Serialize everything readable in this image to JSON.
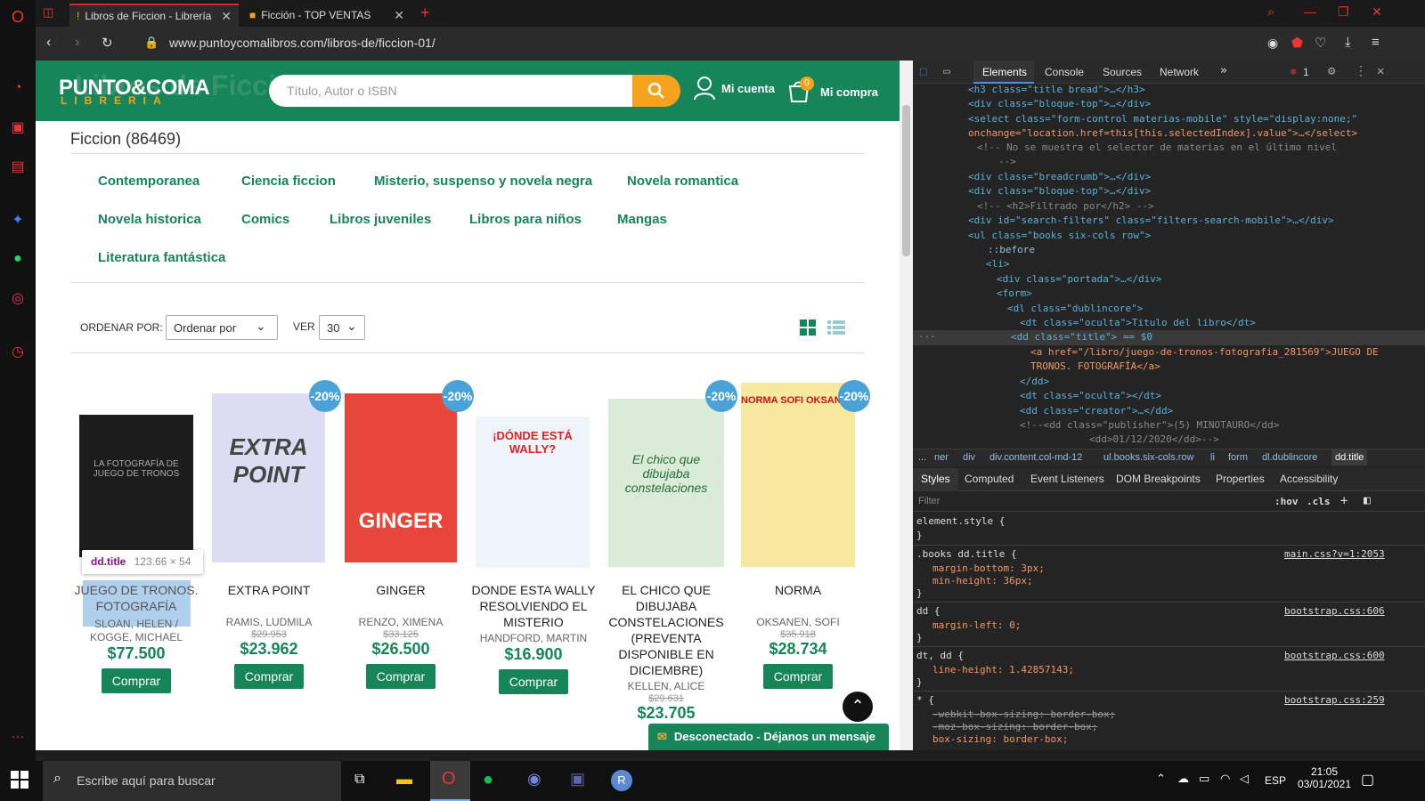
{
  "browser": {
    "tabs": [
      {
        "label": "Libros de Ficcion - Librería"
      },
      {
        "label": "Ficción - TOP VENTAS"
      }
    ],
    "url": "www.puntoycomalibros.com/libros-de/ficcion-01/",
    "new_tab": "+"
  },
  "site": {
    "logo_line1": "PUNTO&COMA",
    "logo_line2": "LIBRERIA",
    "ghost_title": "Libros de Ficcion",
    "search_placeholder": "Título, Autor o ISBN",
    "account_label": "Mi cuenta",
    "cart_label": "Mi compra",
    "cart_count": "0",
    "section_title": "Ficcion (86469)",
    "categories": [
      "Contemporanea",
      "Ciencia ficcion",
      "Misterio, suspenso y novela negra",
      "Novela romantica",
      "Novela historica",
      "Comics",
      "Libros juveniles",
      "Libros para niños",
      "Mangas",
      "Literatura fantástica"
    ],
    "sort_label": "ORDENAR POR:",
    "sort_value": "Ordenar por",
    "view_label": "VER",
    "view_value": "30",
    "tooltip_tag": "dd.title",
    "tooltip_size": "123.66 × 54",
    "chat_label": "Desconectado - Déjanos un mensaje",
    "books": [
      {
        "title": "JUEGO DE TRONOS. FOTOGRAFÍA",
        "author": "SLOAN, HELEN / KOGGE, MICHAEL",
        "old_price": "",
        "price": "$77.500",
        "badge": "",
        "buy": "Comprar",
        "cover_text": "LA FOTOGRAFÍA DE JUEGO DE TRONOS"
      },
      {
        "title": "EXTRA POINT",
        "author": "RAMIS, LUDMILA",
        "old_price": "$29.953",
        "price": "$23.962",
        "badge": "-20%",
        "buy": "Comprar",
        "cover_text": "EXTRA POINT"
      },
      {
        "title": "GINGER",
        "author": "RENZO, XIMENA",
        "old_price": "$33.125",
        "price": "$26.500",
        "badge": "-20%",
        "buy": "Comprar",
        "cover_text": "GINGER"
      },
      {
        "title": "DONDE ESTA WALLY RESOLVIENDO EL MISTERIO",
        "author": "HANDFORD, MARTIN",
        "old_price": "",
        "price": "$16.900",
        "badge": "",
        "buy": "Comprar",
        "cover_text": "¡DÓNDE ESTÁ WALLY?"
      },
      {
        "title": "EL CHICO QUE DIBUJABA CONSTELACIONES (PREVENTA DISPONIBLE EN DICIEMBRE)",
        "author": "KELLEN, ALICE",
        "old_price": "$29.631",
        "price": "$23.705",
        "badge": "-20%",
        "buy": "Comprar",
        "cover_text": "El chico que dibujaba constelaciones"
      },
      {
        "title": "NORMA",
        "author": "OKSANEN, SOFI",
        "old_price": "$35.918",
        "price": "$28.734",
        "badge": "-20%",
        "buy": "Comprar",
        "cover_text": "NORMA SOFI OKSANEN"
      }
    ]
  },
  "devtools": {
    "tabs": [
      "Elements",
      "Console",
      "Sources",
      "Network"
    ],
    "error_count": "1",
    "lines": [
      "<h3 class=\"title bread\">…</h3>",
      "<div class=\"bloque-top\">…</div>",
      "<select class=\"form-control materias-mobile\" style=\"display:none;\"",
      "onchange=\"location.href=this[this.selectedIndex].value\">…</select>",
      "<!-- No se muestra el selector de materias en el último nivel",
      "-->",
      "<div class=\"breadcrumb\">…</div>",
      "<div class=\"bloque-top\">…</div>",
      "<!--      <h2>Filtrado por</h2> -->",
      "<div id=\"search-filters\" class=\"filters-search-mobile\">…</div>",
      "<ul class=\"books six-cols row\">",
      "::before",
      "<li>",
      "<div class=\"portada\">…</div>",
      "<form>",
      "<dl class=\"dublincore\">",
      "<dt class=\"oculta\">Titulo del libro</dt>",
      "<dd class=\"title\"> == $0",
      "<a href=\"/libro/juego-de-tronos-fotografia_281569\">JUEGO DE",
      "TRONOS. FOTOGRAFÍA</a>",
      "</dd>",
      "<dt class=\"oculta\"></dt>",
      "<dd class=\"creator\">…</dd>",
      "<!--<dd class=\"publisher\">(5) MINOTAURO</dd>",
      "<dd>01/12/2020</dd>-->"
    ],
    "crumbs": [
      "...",
      "ner",
      "div",
      "div.content.col-md-12",
      "ul.books.six-cols.row",
      "li",
      "form",
      "dl.dublincore",
      "dd.title"
    ],
    "subtabs": [
      "Styles",
      "Computed",
      "Event Listeners",
      "DOM Breakpoints",
      "Properties",
      "Accessibility"
    ],
    "filter": "Filter",
    "hov": ":hov",
    "cls": ".cls",
    "rules": [
      {
        "sel": "element.style {",
        "src": "",
        "props": []
      },
      {
        "sel": ".books dd.title {",
        "src": "main.css?v=1:2053",
        "props": [
          "margin-bottom: 3px;",
          "min-height: 36px;"
        ]
      },
      {
        "sel": "dd {",
        "src": "bootstrap.css:606",
        "props": [
          "margin-left: 0;"
        ]
      },
      {
        "sel": "dt, dd {",
        "src": "bootstrap.css:600",
        "props": [
          "line-height: 1.42857143;"
        ]
      },
      {
        "sel": "* {",
        "src": "bootstrap.css:259",
        "props": [
          "-webkit-box-sizing: border-box;",
          "-moz-box-sizing: border-box;",
          "box-sizing: border-box;"
        ]
      }
    ]
  },
  "taskbar": {
    "search_placeholder": "Escribe aquí para buscar",
    "lang": "ESP",
    "time": "21:05",
    "date": "03/01/2021"
  },
  "colors": {
    "brand": "#17855a",
    "accent": "#f5a21c",
    "badge": "#4aa3d8"
  }
}
